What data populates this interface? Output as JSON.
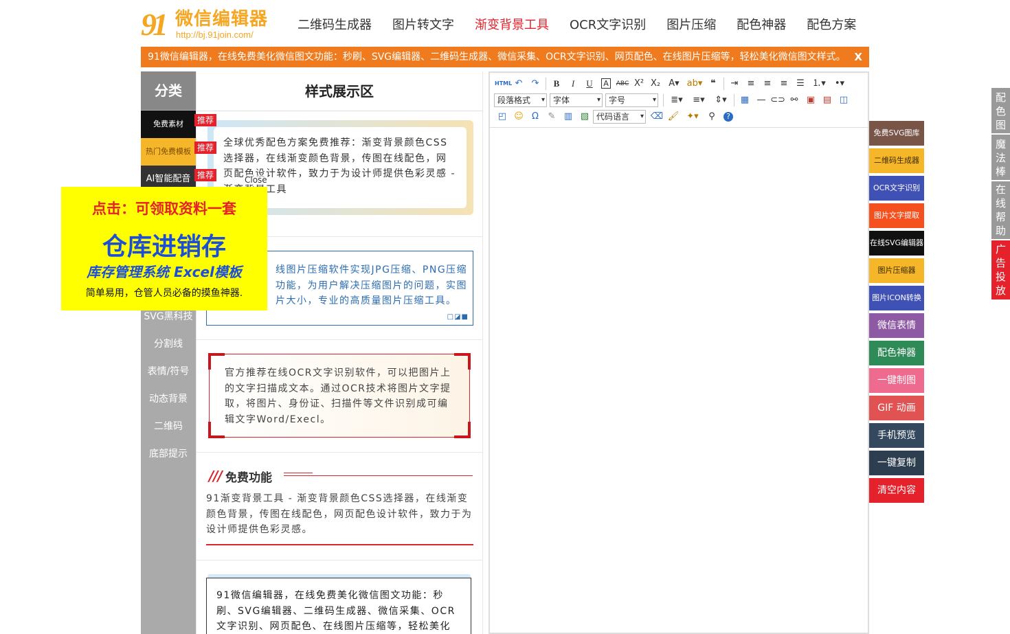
{
  "logo": {
    "mark": "91",
    "name": "微信编辑器",
    "url": "http://bj.91join.com/"
  },
  "nav": [
    "二维码生成器",
    "图片转文字",
    "渐变背景工具",
    "OCR文字识别",
    "图片压缩",
    "配色神器",
    "配色方案"
  ],
  "nav_active": 2,
  "notice": {
    "text": "91微信编辑器，在线免费美化微信图文功能：秒刷、SVG编辑器、二维码生成器、微信采集、OCR文字识别、网页配色、在线图片压缩等，轻松美化微信图文样式。",
    "close": "X"
  },
  "category": {
    "title": "分类",
    "items": [
      "免费素材",
      "热门免费模板",
      "AI智能配音",
      "",
      "",
      "",
      "SVG黑科技",
      "分割线",
      "表情/符号",
      "动态背景",
      "二维码",
      "底部提示"
    ],
    "tag": "推荐"
  },
  "style_area": {
    "title": "样式展示区",
    "block1": "全球优秀配色方案免费推荐：渐变背景颜色CSS选择器，在线渐变颜色背景，传图在线配色，网页配色设计软件，致力于为设计师提供色彩灵感 - 渐变背景工具",
    "close": "Close",
    "block2": "线图片压缩软件实现JPG压缩、PNG压缩功能，为用户解决压缩图片的问题，实图片大小，专业的高质量图片压缩工具。",
    "block3": "官方推荐在线OCR文字识别软件，可以把图片上的文字扫描成文本。通过OCR技术将图片文字提取，将图片、身份证、扫描件等文件识别成可编辑文字Word/Execl。",
    "block4_title": "免费功能",
    "block4": "91渐变背景工具 - 渐变背景颜色CSS选择器，在线渐变颜色背景，传图在线配色，网页配色设计软件，致力于为设计师提供色彩灵感。",
    "block5": "91微信编辑器，在线免费美化微信图文功能：秒刷、SVG编辑器、二维码生成器、微信采集、OCR文字识别、网页配色、在线图片压缩等，轻松美化"
  },
  "editor": {
    "para": "段落格式",
    "font": "字体",
    "size": "字号",
    "code": "代码语言",
    "html": "HTML"
  },
  "right_tools": [
    {
      "label": "免费SVG图库",
      "color": "#795548"
    },
    {
      "label": "二维码生成器",
      "color": "#f5b62a"
    },
    {
      "label": "OCR文字识别",
      "color": "#3f51b5"
    },
    {
      "label": "图片文字提取",
      "color": "#f4511e"
    },
    {
      "label": "在线SVG编辑器",
      "color": "#111111"
    },
    {
      "label": "图片压缩器",
      "color": "#f5b62a"
    },
    {
      "label": "图片ICON转换",
      "color": "#3f51b5"
    },
    {
      "label": "微信表情",
      "color": "#8e5aa4"
    },
    {
      "label": "配色神器",
      "color": "#2e8b57"
    },
    {
      "label": "一键制图",
      "color": "#ee6a8e"
    },
    {
      "label": "GIF 动画",
      "color": "#e15252"
    },
    {
      "label": "手机预览",
      "color": "#34495e"
    },
    {
      "label": "一键复制",
      "color": "#2c3e50"
    },
    {
      "label": "清空内容",
      "color": "#e5212b"
    }
  ],
  "side_tabs": [
    "配色图",
    "魔法棒",
    "在线帮助",
    "广告投放"
  ],
  "ad": {
    "line1": "点击：可领取资料一套",
    "line2": "仓库进销存",
    "line3": "库存管理系统 Excel模板",
    "line4": "简单易用，仓管人员必备的摸鱼神器."
  }
}
